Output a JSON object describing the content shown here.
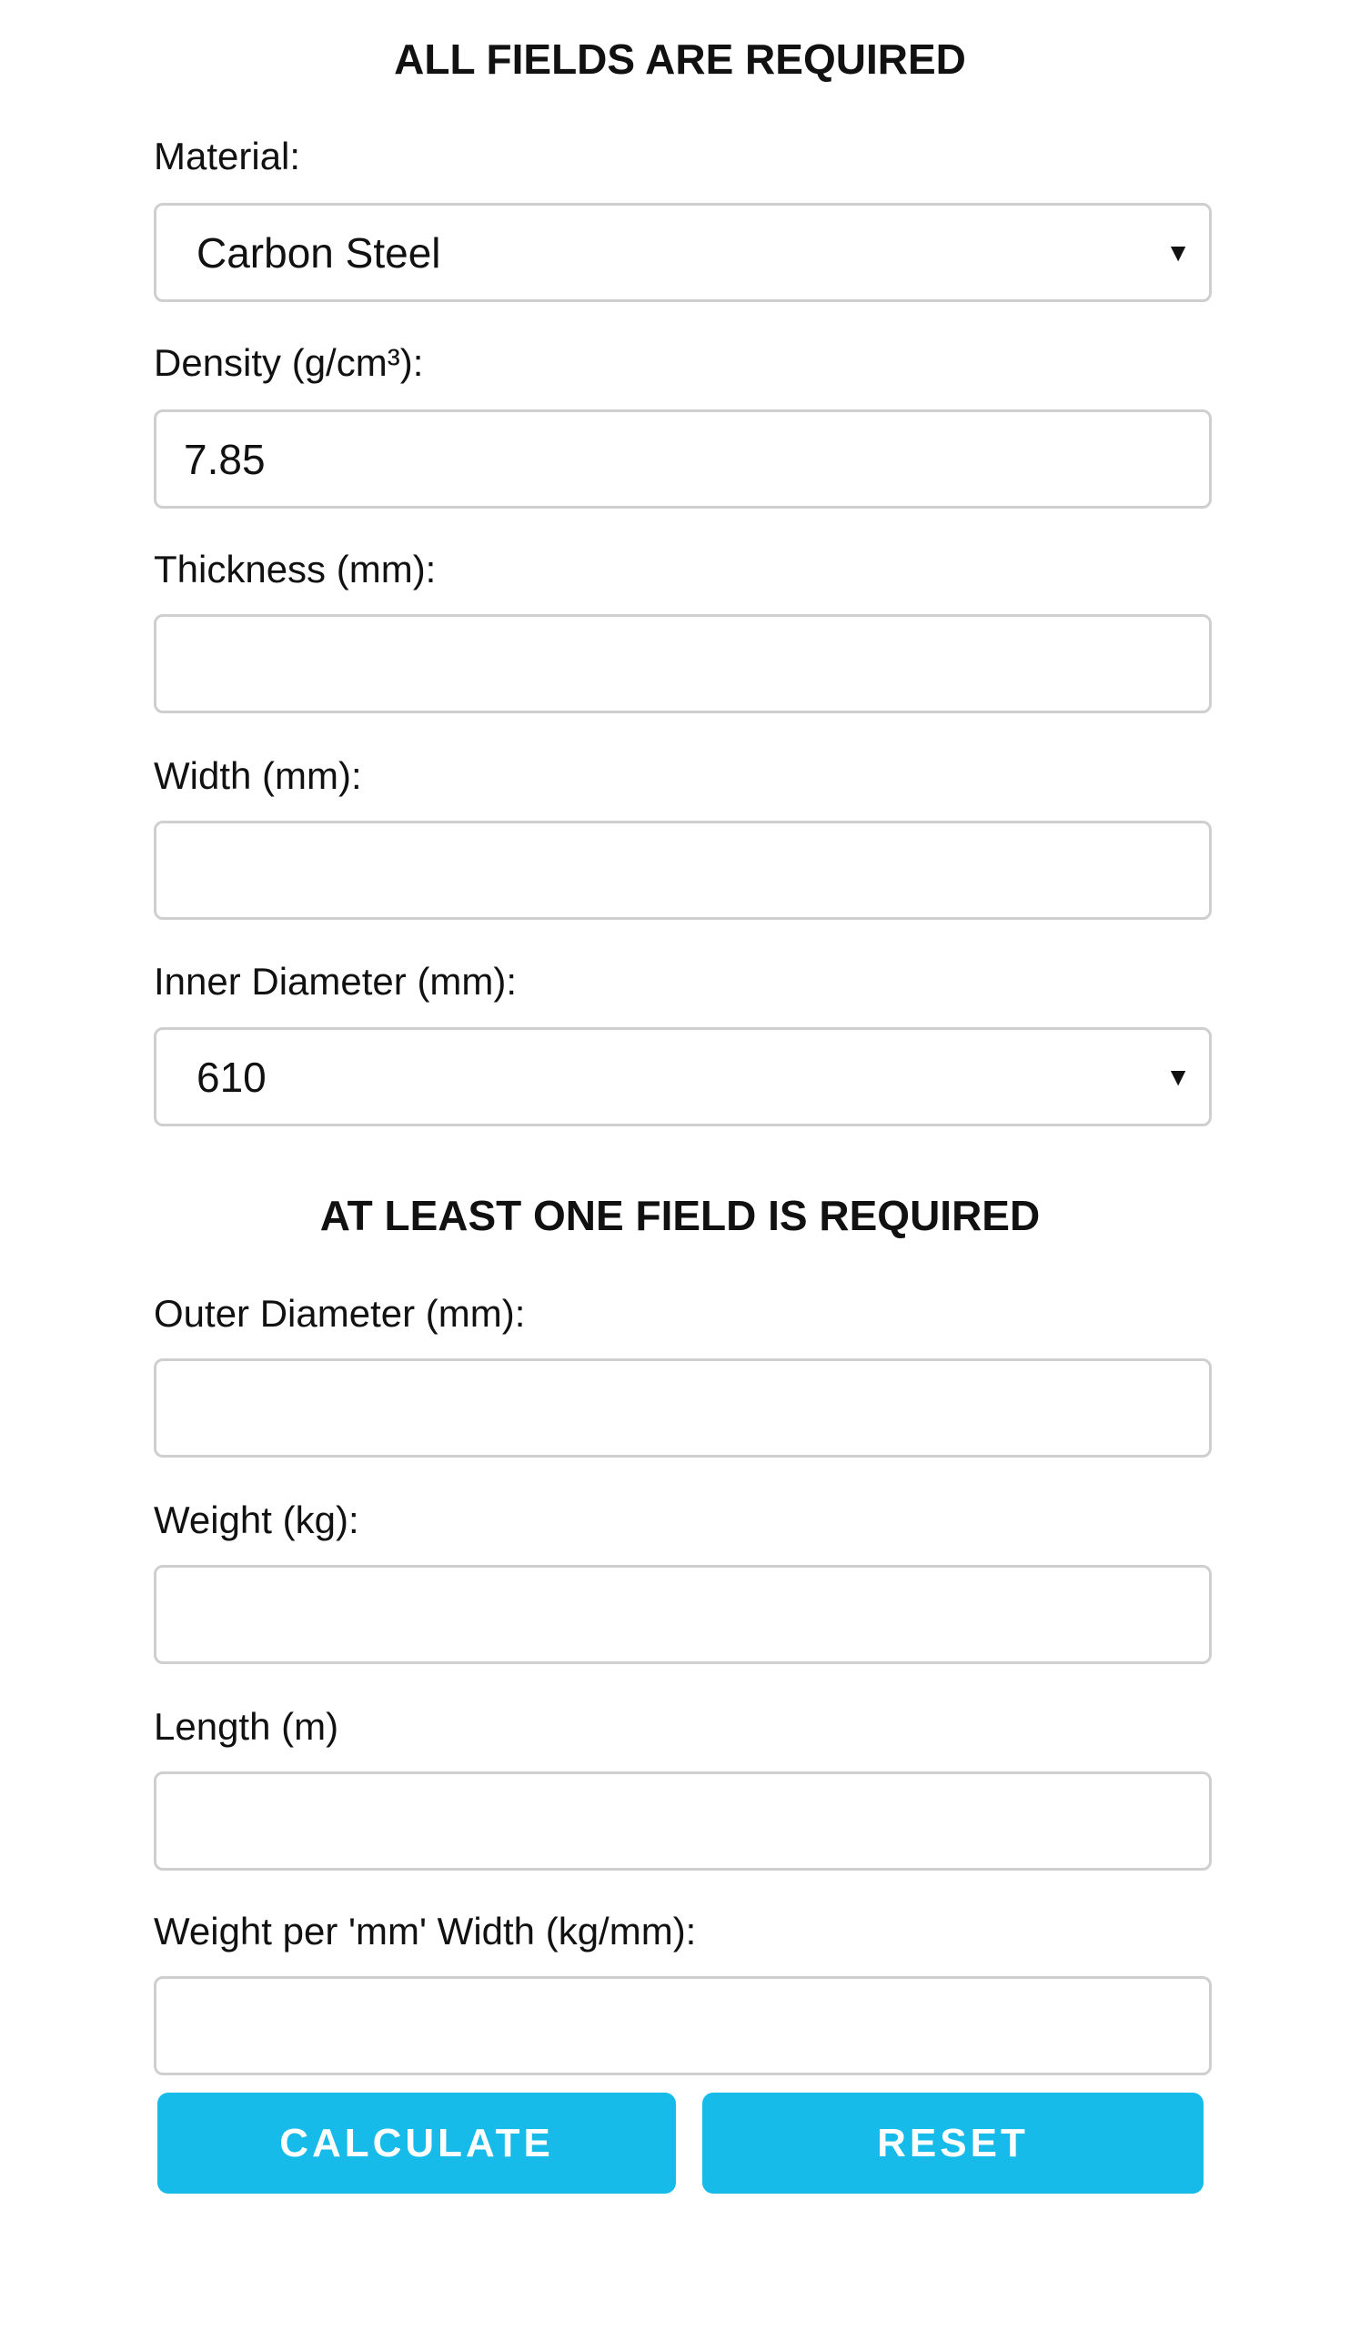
{
  "section_required": {
    "title": "ALL FIELDS ARE REQUIRED"
  },
  "material": {
    "label": "Material:",
    "value": "Carbon Steel"
  },
  "density": {
    "label": "Density (g/cm³):",
    "value": "7.85"
  },
  "thickness": {
    "label": "Thickness (mm):",
    "value": ""
  },
  "width": {
    "label": "Width (mm):",
    "value": ""
  },
  "inner_diameter": {
    "label": "Inner Diameter (mm):",
    "value": "610"
  },
  "section_one_required": {
    "title": "AT LEAST ONE FIELD IS REQUIRED"
  },
  "outer_diameter": {
    "label": "Outer Diameter (mm):",
    "value": ""
  },
  "weight": {
    "label": "Weight (kg):",
    "value": ""
  },
  "length": {
    "label": "Length (m)",
    "value": ""
  },
  "weight_per_mm": {
    "label": "Weight per 'mm' Width (kg/mm):",
    "value": ""
  },
  "buttons": {
    "calculate": "CALCULATE",
    "reset": "RESET"
  },
  "icons": {
    "dropdown": "▼"
  },
  "colors": {
    "accent": "#16bbea",
    "border": "#cfcfcf"
  }
}
